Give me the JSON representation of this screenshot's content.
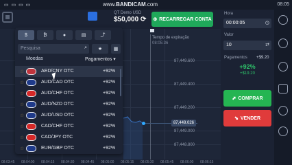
{
  "status": {
    "left": "▭ ▭ ▭ ▭",
    "watermark_pre": "www.",
    "watermark_brand": "BANDICAM",
    "watermark_post": ".com",
    "clock": "08:05"
  },
  "top": {
    "account_label": "QT Demo",
    "currency": "USD",
    "balance": "$50,000",
    "recharge_label": "RECARREGAR CONTA"
  },
  "panel": {
    "search_placeholder": "Pesquisa",
    "col_assets": "Moedas",
    "col_payout": "Pagamentos",
    "rows": [
      {
        "name": "AED/CNY OTC",
        "payout": "+92%"
      },
      {
        "name": "AUD/CAD OTC",
        "payout": "+92%"
      },
      {
        "name": "AUD/CHF OTC",
        "payout": "+92%"
      },
      {
        "name": "AUD/NZD OTC",
        "payout": "+92%"
      },
      {
        "name": "AUD/USD OTC",
        "payout": "+92%"
      },
      {
        "name": "CAD/CHF OTC",
        "payout": "+92%"
      },
      {
        "name": "CAD/JPY OTC",
        "payout": "+92%"
      },
      {
        "name": "EUR/GBP OTC",
        "payout": "+92%"
      }
    ]
  },
  "chart": {
    "expiry_label": "Tempo de expiração",
    "expiry_time": "08:05:36",
    "prices": [
      "87,449.600",
      "87,449.400",
      "87,449.200",
      "87,449.000",
      "87,448.800"
    ],
    "current_price": "87,449.026",
    "times": [
      "08:03:45",
      "08:04:00",
      "08:04:15",
      "08:04:30",
      "08:04:45",
      "08:05:00",
      "08:05:15",
      "08:05:30",
      "08:05:45",
      "08:06:00",
      "08:06:15",
      "08:06:30"
    ]
  },
  "trade": {
    "time_label": "Hora",
    "time_value": "00:00:05",
    "value_label": "Valor",
    "value_value": "10",
    "payout_label": "Pagamentos",
    "payout_value": "+$9.20",
    "payout_pct": "+92%",
    "payout_amount": "+$19.20",
    "buy_label": "COMPRAR",
    "sell_label": "VENDER"
  },
  "colors": {
    "buy": "#25b552",
    "sell": "#e03b3b",
    "recharge": "#1fa85a",
    "accent": "#2fa8ff"
  }
}
